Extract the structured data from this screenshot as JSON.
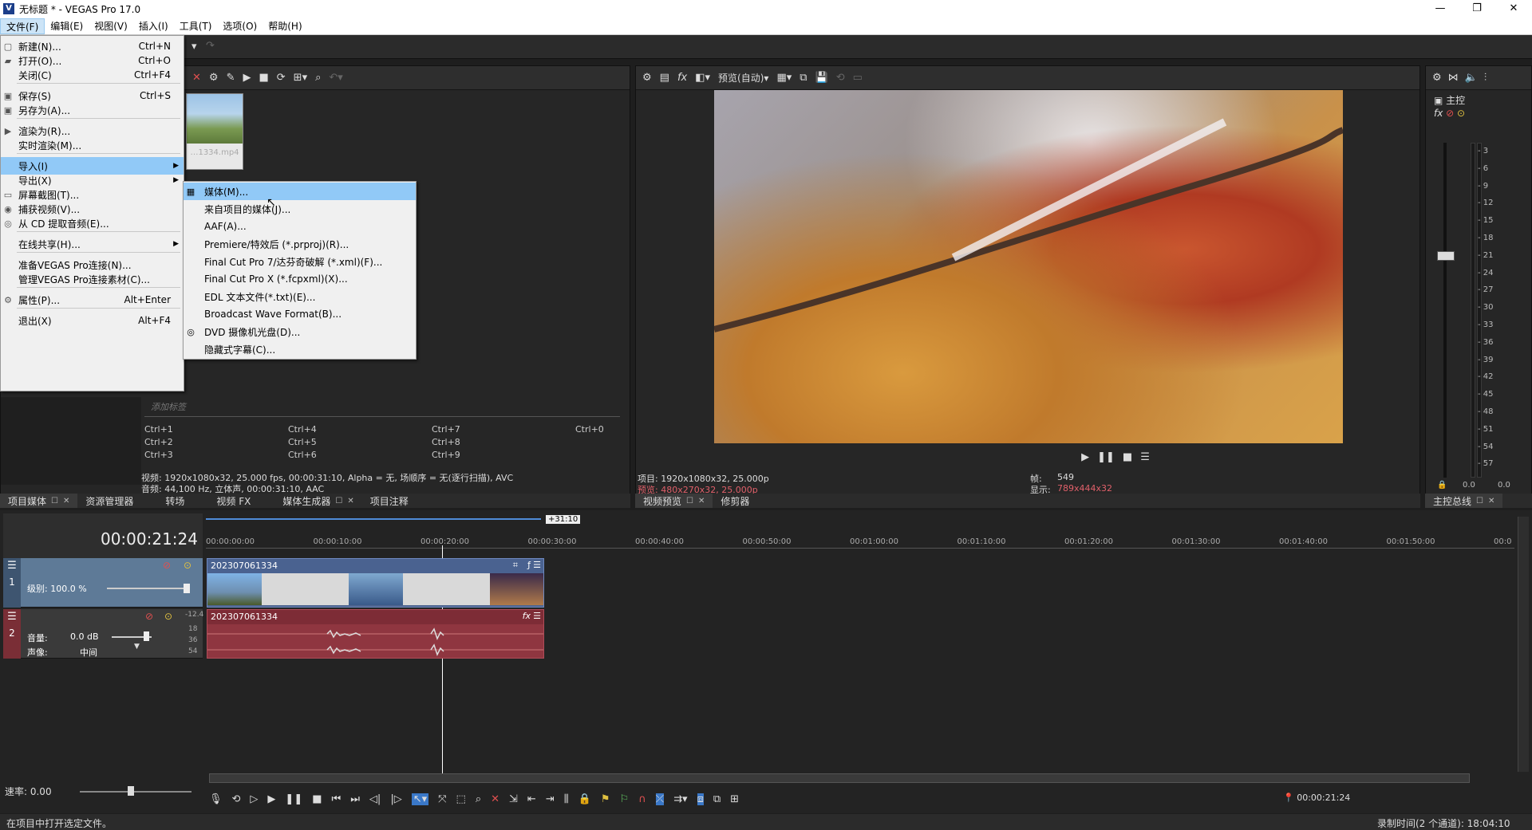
{
  "window": {
    "title": "无标题 * - VEGAS Pro 17.0",
    "icon": "V",
    "minimize": "—",
    "maximize": "❐",
    "close": "✕"
  },
  "menubar": [
    "文件(F)",
    "编辑(E)",
    "视图(V)",
    "插入(I)",
    "工具(T)",
    "选项(O)",
    "帮助(H)"
  ],
  "file_menu": {
    "items": [
      {
        "label": "新建(N)...",
        "shortcut": "Ctrl+N",
        "icon": "new-file-icon"
      },
      {
        "label": "打开(O)...",
        "shortcut": "Ctrl+O",
        "icon": "folder-icon"
      },
      {
        "label": "关闭(C)",
        "shortcut": "Ctrl+F4",
        "icon": ""
      },
      {
        "label": "保存(S)",
        "shortcut": "Ctrl+S",
        "icon": "save-icon"
      },
      {
        "label": "另存为(A)...",
        "shortcut": "",
        "icon": "save-as-icon"
      },
      {
        "label": "渲染为(R)...",
        "shortcut": "",
        "icon": "render-icon"
      },
      {
        "label": "实时渲染(M)...",
        "shortcut": "",
        "icon": ""
      },
      {
        "label": "导入(I)",
        "shortcut": "",
        "icon": "",
        "submenu": true
      },
      {
        "label": "导出(X)",
        "shortcut": "",
        "icon": "",
        "submenu": true
      },
      {
        "label": "屏幕截图(T)...",
        "shortcut": "",
        "icon": "screenshot-icon"
      },
      {
        "label": "捕获视频(V)...",
        "shortcut": "",
        "icon": "capture-icon"
      },
      {
        "label": "从 CD 提取音频(E)...",
        "shortcut": "",
        "icon": "cd-icon"
      },
      {
        "label": "在线共享(H)...",
        "shortcut": "",
        "icon": "",
        "submenu": true
      },
      {
        "label": "准备VEGAS Pro连接(N)...",
        "shortcut": "",
        "icon": ""
      },
      {
        "label": "管理VEGAS Pro连接素材(C)...",
        "shortcut": "",
        "icon": ""
      },
      {
        "label": "属性(P)...",
        "shortcut": "Alt+Enter",
        "icon": "gear-icon"
      },
      {
        "label": "退出(X)",
        "shortcut": "Alt+F4",
        "icon": ""
      }
    ]
  },
  "import_submenu": [
    "媒体(M)...",
    "来自项目的媒体(J)...",
    "AAF(A)...",
    "Premiere/特效后 (*.prproj)(R)...",
    "Final Cut Pro 7/达芬奇破解 (*.xml)(F)...",
    "Final Cut Pro X (*.fcpxml)(X)...",
    "EDL 文本文件(*.txt)(E)...",
    "Broadcast Wave Format(B)...",
    "DVD 摄像机光盘(D)...",
    "隐藏式字幕(C)..."
  ],
  "media_panel": {
    "thumb_caption": "…1334.mp4",
    "tag_placeholder": "添加标签",
    "shortcuts": [
      "Ctrl+1",
      "Ctrl+4",
      "Ctrl+7",
      "Ctrl+0",
      "Ctrl+2",
      "Ctrl+5",
      "Ctrl+8",
      "Ctrl+3",
      "Ctrl+6",
      "Ctrl+9"
    ],
    "video_info": "视频: 1920x1080x32, 25.000 fps, 00:00:31:10, Alpha = 无, 场顺序 = 无(逐行扫描), AVC",
    "audio_info": "音频: 44,100 Hz, 立体声, 00:00:31:10, AAC",
    "tabs": [
      "项目媒体",
      "资源管理器",
      "转场",
      "视频 FX",
      "媒体生成器",
      "项目注释"
    ]
  },
  "preview": {
    "toolbar_label": "预览(自动)",
    "project_info": "项目: 1920x1080x32, 25.000p",
    "preview_info": "预览: 480x270x32, 25.000p",
    "frame_label": "帧:",
    "frame_value": "549",
    "display_label": "显示:",
    "display_value": "789x444x32",
    "tabs": [
      "视频预览",
      "修剪器"
    ]
  },
  "master": {
    "label": "主控",
    "scale": [
      "3",
      "6",
      "9",
      "12",
      "15",
      "18",
      "21",
      "24",
      "27",
      "30",
      "33",
      "36",
      "39",
      "42",
      "45",
      "48",
      "51",
      "54",
      "57"
    ],
    "level_left": "0.0",
    "level_right": "0.0",
    "tab": "主控总线"
  },
  "timeline": {
    "timecode": "00:00:21:24",
    "marker_label": "+31:10",
    "ruler": [
      "00:00:00:00",
      "00:00:10:00",
      "00:00:20:00",
      "00:00:30:00",
      "00:00:40:00",
      "00:00:50:00",
      "00:01:00:00",
      "00:01:10:00",
      "00:01:20:00",
      "00:01:30:00",
      "00:01:40:00",
      "00:01:50:00",
      "00:0"
    ],
    "video_track": {
      "number": "1",
      "level_label": "级别: 100.0 %",
      "clip_name": "202307061334"
    },
    "audio_track": {
      "number": "2",
      "volume_label": "音量:",
      "volume_value": "0.0 dB",
      "pan_label": "声像:",
      "pan_value": "中间",
      "clip_name": "202307061334",
      "db_scale": [
        "-12.4",
        "18",
        "36",
        "54"
      ]
    },
    "rate_label": "速率: 0.00",
    "end_timecode": "00:00:21:24"
  },
  "statusbar": {
    "left": "在项目中打开选定文件。",
    "right": "录制时间(2 个通道): 18:04:10"
  },
  "colors": {
    "accent": "#91c9f7",
    "video_clip": "#4f6590",
    "audio_clip": "#8f3640",
    "preview_info_red": "#e0606a"
  }
}
